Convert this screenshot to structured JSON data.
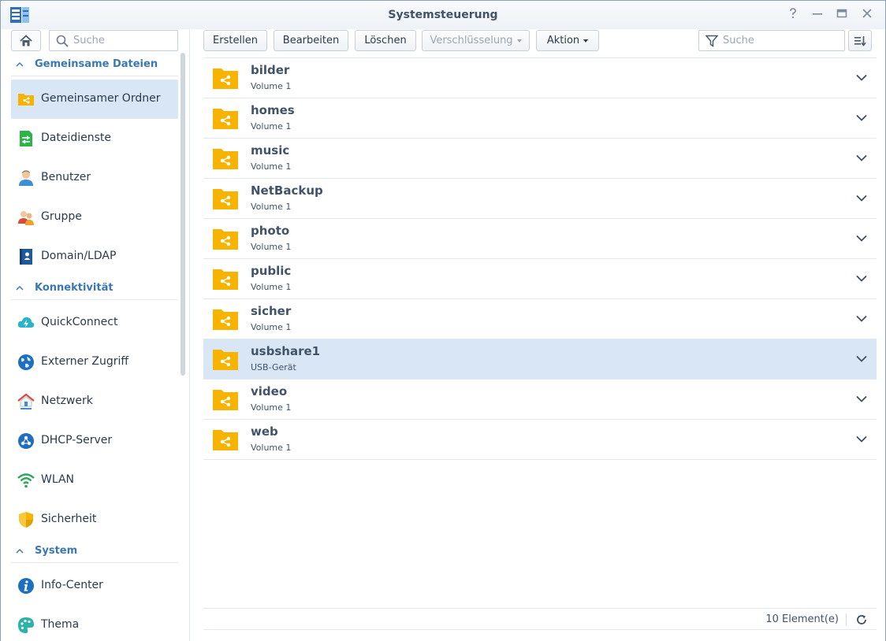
{
  "window": {
    "title": "Systemsteuerung"
  },
  "sidebar": {
    "search_placeholder": "Suche",
    "sections": [
      {
        "label": "Gemeinsame Dateien",
        "items": [
          {
            "label": "Gemeinsamer Ordner",
            "icon": "shared-folder-icon",
            "active": true
          },
          {
            "label": "Dateidienste",
            "icon": "file-services-icon"
          },
          {
            "label": "Benutzer",
            "icon": "user-icon"
          },
          {
            "label": "Gruppe",
            "icon": "group-icon"
          },
          {
            "label": "Domain/LDAP",
            "icon": "domain-ldap-icon"
          }
        ]
      },
      {
        "label": "Konnektivität",
        "items": [
          {
            "label": "QuickConnect",
            "icon": "quickconnect-icon"
          },
          {
            "label": "Externer Zugriff",
            "icon": "globe-icon"
          },
          {
            "label": "Netzwerk",
            "icon": "network-house-icon"
          },
          {
            "label": "DHCP-Server",
            "icon": "dhcp-icon"
          },
          {
            "label": "WLAN",
            "icon": "wifi-icon"
          },
          {
            "label": "Sicherheit",
            "icon": "shield-icon"
          }
        ]
      },
      {
        "label": "System",
        "items": [
          {
            "label": "Info-Center",
            "icon": "info-icon"
          },
          {
            "label": "Thema",
            "icon": "palette-icon"
          }
        ]
      }
    ]
  },
  "toolbar": {
    "create_label": "Erstellen",
    "edit_label": "Bearbeiten",
    "delete_label": "Löschen",
    "encryption_label": "Verschlüsselung",
    "action_label": "Aktion",
    "search_placeholder": "Suche"
  },
  "folders": [
    {
      "name": "bilder",
      "location": "Volume 1"
    },
    {
      "name": "homes",
      "location": "Volume 1"
    },
    {
      "name": "music",
      "location": "Volume 1"
    },
    {
      "name": "NetBackup",
      "location": "Volume 1"
    },
    {
      "name": "photo",
      "location": "Volume 1"
    },
    {
      "name": "public",
      "location": "Volume 1"
    },
    {
      "name": "sicher",
      "location": "Volume 1"
    },
    {
      "name": "usbshare1",
      "location": "USB-Gerät",
      "selected": true
    },
    {
      "name": "video",
      "location": "Volume 1"
    },
    {
      "name": "web",
      "location": "Volume 1"
    }
  ],
  "footer": {
    "count_label": "10 Element(e)"
  },
  "colors": {
    "accent": "#3a78b4",
    "folder": "#f6b400",
    "selected": "#d8e6f5"
  }
}
